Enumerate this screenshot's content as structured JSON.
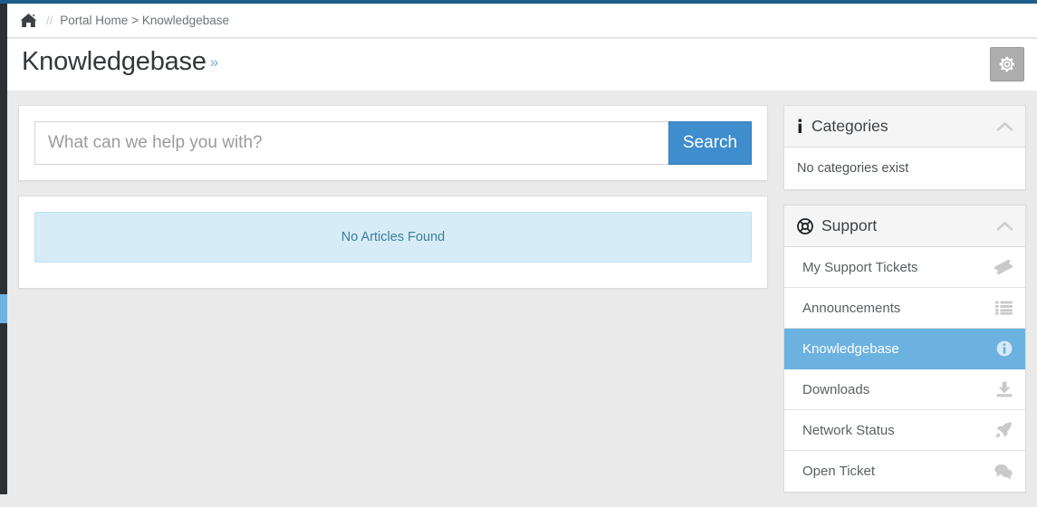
{
  "theme": {
    "accent_blue": "#3f8dcc",
    "active_blue": "#6cb2e0",
    "top_bar": "#1d5f8a",
    "rail_dark": "#2b3034",
    "body_bg": "#eaeaea",
    "alert_bg": "#d6ecf7"
  },
  "breadcrumb": {
    "home_icon": "home-icon",
    "separator": "//",
    "home_label": "Portal Home",
    "trail": "> Knowledgebase"
  },
  "header": {
    "title": "Knowledgebase",
    "title_chevron": "»",
    "settings_icon": "gear-icon"
  },
  "search": {
    "placeholder": "What can we help you with?",
    "value": "",
    "button_label": "Search"
  },
  "articles": {
    "empty_message": "No Articles Found"
  },
  "sidebar": {
    "panels": [
      {
        "id": "categories",
        "icon": "info-i-icon",
        "title": "Categories",
        "toggle_icon": "chevron-up-icon",
        "empty_text": "No categories exist",
        "items": []
      },
      {
        "id": "support",
        "icon": "life-ring-icon",
        "title": "Support",
        "toggle_icon": "chevron-up-icon",
        "empty_text": "",
        "items": [
          {
            "label": "My Support Tickets",
            "icon": "ticket-icon",
            "active": false
          },
          {
            "label": "Announcements",
            "icon": "list-icon",
            "active": false
          },
          {
            "label": "Knowledgebase",
            "icon": "info-circle-icon",
            "active": true
          },
          {
            "label": "Downloads",
            "icon": "download-icon",
            "active": false
          },
          {
            "label": "Network Status",
            "icon": "rocket-icon",
            "active": false
          },
          {
            "label": "Open Ticket",
            "icon": "comments-icon",
            "active": false
          }
        ]
      }
    ]
  }
}
